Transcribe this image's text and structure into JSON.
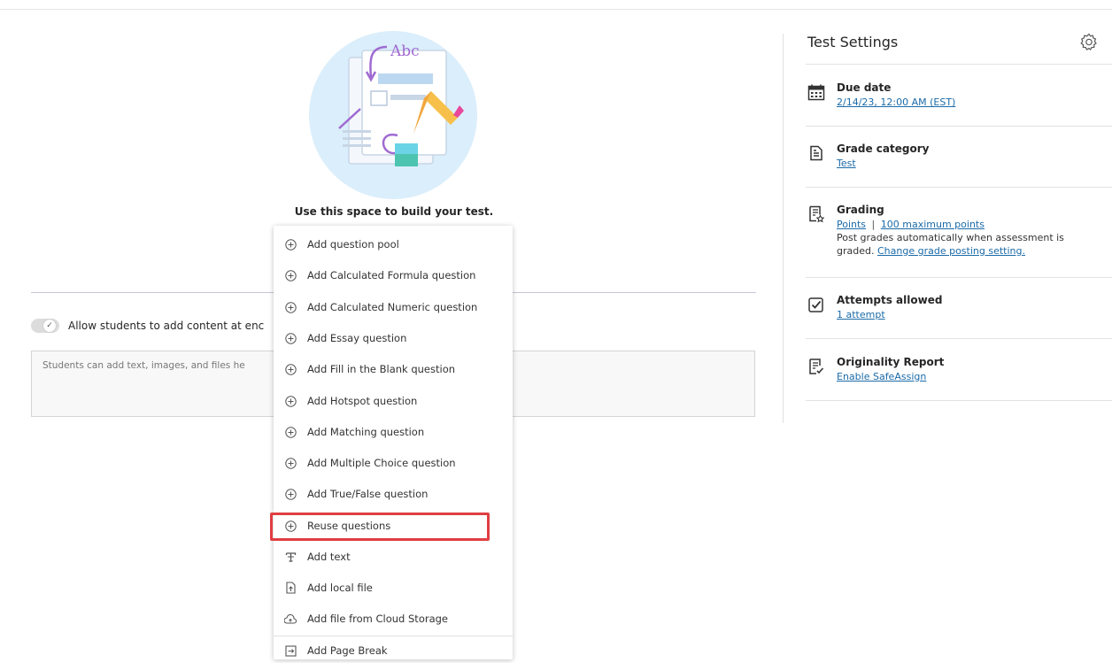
{
  "main": {
    "illustration_text": "Abc",
    "build_title": "Use this space to build your test.",
    "toggle_label": "Allow students to add content at enc",
    "student_box_text": "Students can add text, images, and files he"
  },
  "menu": {
    "items": [
      {
        "label": "Add question pool",
        "icon": "plus-circle-icon"
      },
      {
        "label": "Add Calculated Formula question",
        "icon": "plus-circle-icon"
      },
      {
        "label": "Add Calculated Numeric question",
        "icon": "plus-circle-icon"
      },
      {
        "label": "Add Essay question",
        "icon": "plus-circle-icon"
      },
      {
        "label": "Add Fill in the Blank question",
        "icon": "plus-circle-icon"
      },
      {
        "label": "Add Hotspot question",
        "icon": "plus-circle-icon"
      },
      {
        "label": "Add Matching question",
        "icon": "plus-circle-icon"
      },
      {
        "label": "Add Multiple Choice question",
        "icon": "plus-circle-icon"
      },
      {
        "label": "Add True/False question",
        "icon": "plus-circle-icon"
      },
      {
        "label": "Reuse questions",
        "icon": "plus-circle-icon"
      },
      {
        "label": "Add text",
        "icon": "text-icon"
      },
      {
        "label": "Add local file",
        "icon": "local-file-icon"
      },
      {
        "label": "Add file from Cloud Storage",
        "icon": "cloud-storage-icon"
      },
      {
        "label": "Add Page Break",
        "icon": "page-break-icon"
      }
    ],
    "highlighted_item": "Reuse questions",
    "highlight_color": "#e03e42"
  },
  "settings": {
    "title": "Test Settings",
    "due_date": {
      "title": "Due date",
      "value": "2/14/23, 12:00 AM (EST)"
    },
    "grade_category": {
      "title": "Grade category",
      "value": "Test"
    },
    "grading": {
      "title": "Grading",
      "type": "Points",
      "separator": "|",
      "max_points": "100 maximum points",
      "posting_line1": "Post grades automatically when assessment is",
      "posting_line2_prefix": "graded.",
      "posting_link": "Change grade posting setting."
    },
    "attempts": {
      "title": "Attempts allowed",
      "value": "1 attempt"
    },
    "originality": {
      "title": "Originality Report",
      "value": "Enable SafeAssign"
    }
  },
  "colors": {
    "link": "#1b6ba8",
    "illustration_bg": "#dbeefb"
  }
}
